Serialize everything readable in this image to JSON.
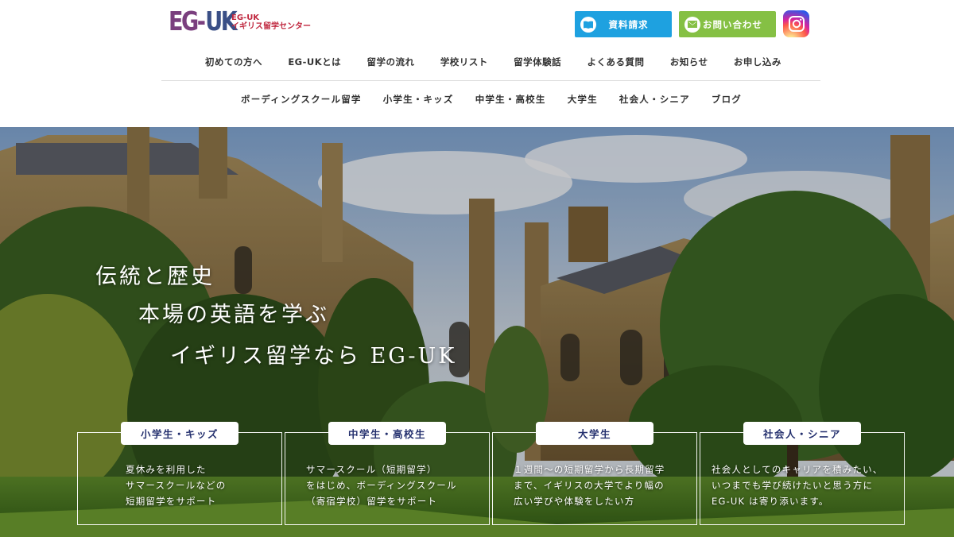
{
  "brand": {
    "logo_mark_left": "EG",
    "logo_mark_right": "UK",
    "logo_sub_line1": "EG-UK",
    "logo_sub_line2": "イギリス留学センター"
  },
  "header_buttons": {
    "document_request": "資料請求",
    "contact": "お問い合わせ"
  },
  "nav_primary": [
    "初めての方へ",
    "EG-UKとは",
    "留学の流れ",
    "学校リスト",
    "留学体験話",
    "よくある質問",
    "お知らせ",
    "お申し込み"
  ],
  "nav_secondary": [
    "ボーディングスクール留学",
    "小学生・キッズ",
    "中学生・高校生",
    "大学生",
    "社会人・シニア",
    "ブログ"
  ],
  "hero": {
    "line1": "伝統と歴史",
    "line2": "本場の英語を学ぶ",
    "line3": "イギリス留学なら EG-UK"
  },
  "cards": [
    {
      "title": "小学生・キッズ",
      "desc": "夏休みを利用した\nサマースクールなどの\n短期留学をサポート"
    },
    {
      "title": "中学生・高校生",
      "desc": "サマースクール（短期留学）\nをはじめ、ボーディングスクール\n（寄宿学校）留学をサポート"
    },
    {
      "title": "大学生",
      "desc": "１週間〜の短期留学から長期留学\nまで、イギリスの大学でより幅の\n広い学びや体験をしたい方"
    },
    {
      "title": "社会人・シニア",
      "desc": "社会人としてのキャリアを積みたい、\nいつまでも学び続けたいと思う方に\nEG-UK は寄り添います。"
    }
  ],
  "colors": {
    "doc_button": "#1ea1e0",
    "contact_button": "#85c044",
    "card_title": "#24306e",
    "logo_purple": "#7a3f7e",
    "logo_navy": "#3a4f86",
    "logo_sub": "#c0283f"
  },
  "icons": [
    "book-icon",
    "mail-icon",
    "instagram-icon"
  ]
}
